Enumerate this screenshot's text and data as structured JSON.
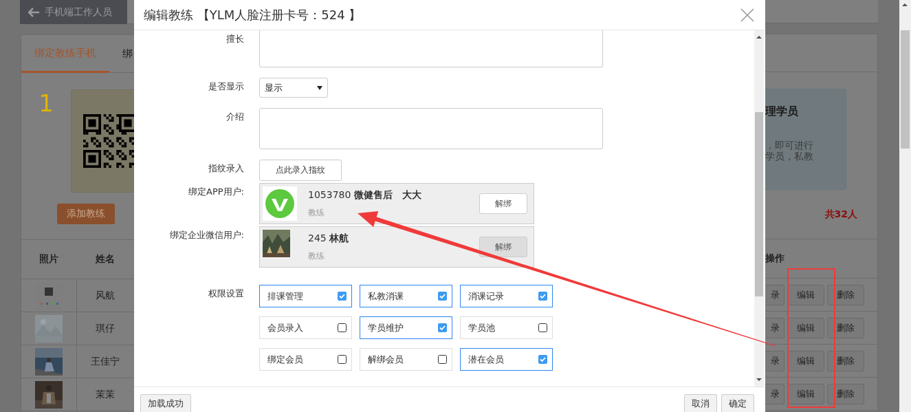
{
  "background": {
    "back_button": "手机端工作人员",
    "tabs": [
      {
        "label": "绑定教练手机",
        "selected": true
      },
      {
        "label": "绑",
        "selected": false
      }
    ],
    "step_number": "1",
    "add_button": "添加教练",
    "info_panel": {
      "title": "理学员",
      "lines": [
        "，即可进行",
        "学员，私教"
      ]
    },
    "total": "共32人",
    "table": {
      "columns": [
        "照片",
        "姓名",
        "操作"
      ],
      "rows": [
        {
          "name": "风航",
          "actions": [
            "录",
            "编辑",
            "删除"
          ]
        },
        {
          "name": "琪仔",
          "actions": [
            "录",
            "编辑",
            "删除"
          ]
        },
        {
          "name": "王佳宁",
          "actions": [
            "录",
            "编辑",
            "删除"
          ]
        },
        {
          "name": "茉茉",
          "actions": [
            "录",
            "编辑",
            "删除"
          ]
        }
      ]
    }
  },
  "dialog": {
    "title": "编辑教练 【YLM人脸注册卡号：524 】",
    "fields": [
      {
        "kind": "textarea",
        "label": "擅长"
      },
      {
        "kind": "select",
        "label": "是否显示",
        "value": "显示"
      },
      {
        "kind": "textarea",
        "label": "介绍"
      },
      {
        "kind": "button",
        "label": "指纹录入",
        "button": "点此录入指纹"
      },
      {
        "kind": "binding",
        "label": "绑定APP用户:",
        "avatar": {
          "kind": "logo"
        },
        "id": "1053780",
        "name": "微健售后　大大",
        "role": "教练",
        "button": "解绑",
        "button_hovered": false
      },
      {
        "kind": "binding",
        "label": "绑定企业微信用户:",
        "id": "245",
        "name": "林航",
        "role": "教练",
        "button": "解绑",
        "button_hovered": true
      }
    ],
    "permissions_label": "权限设置",
    "permissions": [
      {
        "label": "排课管理",
        "checked": true
      },
      {
        "label": "私教消课",
        "checked": true
      },
      {
        "label": "消课记录",
        "checked": true
      },
      {
        "label": "会员录入",
        "checked": false
      },
      {
        "label": "学员维护",
        "checked": true
      },
      {
        "label": "学员池",
        "checked": false
      },
      {
        "label": "绑定会员",
        "checked": false
      },
      {
        "label": "解绑会员",
        "checked": false
      },
      {
        "label": "潜在会员",
        "checked": true
      }
    ],
    "footer": {
      "status": "加载成功",
      "buttons": [
        "取消",
        "确定"
      ]
    }
  }
}
